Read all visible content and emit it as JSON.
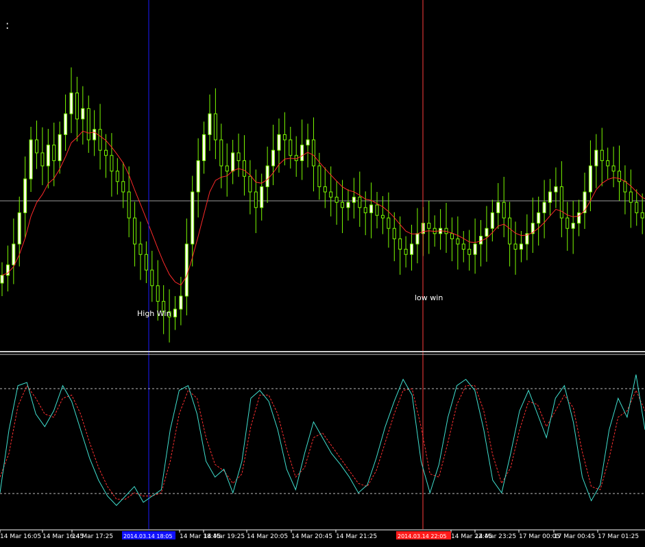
{
  "corner_glyph": ":",
  "colors": {
    "background": "#000000",
    "candle_up_fill": "#FFFFEE",
    "candle_outline": "#7CFC00",
    "moving_average": "#FF0000",
    "stoch_main": "#40E0D0",
    "stoch_signal": "#FF3030",
    "crosshair_blue": "#0000FF",
    "crosshair_red": "#FF3B3B",
    "horizontal_line": "#AAAAAA",
    "text": "#FFFFFF"
  },
  "annotations": {
    "high_win": "High Win",
    "low_win": "low win"
  },
  "time_axis": {
    "labels": [
      "14 Mar 16:05",
      "14 Mar 16:45",
      "14 Mar 17:25",
      "14 Mar 18:45",
      "14 Mar 19:25",
      "14 Mar 20:05",
      "14 Mar 20:45",
      "14 Mar 21:25",
      "14 Mar 22:45",
      "14 Mar 23:25",
      "17 Mar 00:05",
      "17 Mar 00:45",
      "17 Mar 01:25"
    ],
    "blue_marker_text": "2014.03.14 18:05",
    "red_marker_text": "2014.03.14 22:05"
  },
  "chart_data": [
    {
      "type": "candlestick",
      "title": "",
      "candles_close": [
        0.18,
        0.22,
        0.3,
        0.42,
        0.55,
        0.7,
        0.65,
        0.6,
        0.68,
        0.62,
        0.72,
        0.8,
        0.88,
        0.78,
        0.82,
        0.7,
        0.74,
        0.66,
        0.64,
        0.58,
        0.54,
        0.5,
        0.4,
        0.3,
        0.26,
        0.2,
        0.14,
        0.08,
        0.04,
        0.02,
        0.05,
        0.1,
        0.3,
        0.5,
        0.62,
        0.72,
        0.8,
        0.7,
        0.6,
        0.58,
        0.65,
        0.62,
        0.56,
        0.5,
        0.44,
        0.52,
        0.6,
        0.66,
        0.72,
        0.7,
        0.64,
        0.62,
        0.68,
        0.7,
        0.6,
        0.52,
        0.5,
        0.48,
        0.46,
        0.44,
        0.46,
        0.48,
        0.44,
        0.42,
        0.45,
        0.41,
        0.4,
        0.36,
        0.32,
        0.28,
        0.26,
        0.3,
        0.34,
        0.38,
        0.36,
        0.34,
        0.36,
        0.34,
        0.32,
        0.3,
        0.28,
        0.26,
        0.3,
        0.33,
        0.36,
        0.42,
        0.46,
        0.4,
        0.3,
        0.28,
        0.3,
        0.34,
        0.38,
        0.42,
        0.46,
        0.5,
        0.52,
        0.4,
        0.36,
        0.38,
        0.42,
        0.5,
        0.6,
        0.66,
        0.62,
        0.6,
        0.58,
        0.54,
        0.5,
        0.46,
        0.42,
        0.4,
        0.44
      ]
    },
    {
      "type": "line",
      "title": "",
      "series": [
        {
          "values": [
            20,
            60,
            88,
            90,
            70,
            62,
            72,
            88,
            78,
            60,
            42,
            28,
            18,
            12,
            18,
            24,
            14,
            18,
            22,
            60,
            85,
            88,
            70,
            40,
            30,
            35,
            20,
            40,
            80,
            85,
            78,
            60,
            35,
            22,
            45,
            65,
            55,
            45,
            38,
            30,
            20,
            25,
            42,
            62,
            78,
            92,
            82,
            40,
            20,
            38,
            68,
            88,
            92,
            85,
            60,
            28,
            20,
            45,
            72,
            85,
            70,
            55,
            80,
            88,
            65,
            30,
            15,
            25,
            60,
            80,
            68,
            95,
            60
          ]
        },
        {
          "values": [
            30,
            45,
            75,
            88,
            80,
            70,
            68,
            80,
            82,
            70,
            52,
            36,
            24,
            16,
            16,
            20,
            18,
            18,
            20,
            40,
            70,
            85,
            80,
            55,
            38,
            34,
            26,
            32,
            62,
            82,
            82,
            70,
            48,
            30,
            36,
            55,
            58,
            50,
            42,
            34,
            26,
            24,
            34,
            52,
            70,
            85,
            86,
            62,
            32,
            30,
            52,
            76,
            88,
            88,
            72,
            44,
            26,
            36,
            60,
            78,
            76,
            62,
            72,
            82,
            74,
            46,
            24,
            22,
            42,
            68,
            72,
            85,
            72
          ]
        }
      ],
      "ylim": [
        0,
        100
      ],
      "levels": [
        80,
        20
      ]
    }
  ]
}
